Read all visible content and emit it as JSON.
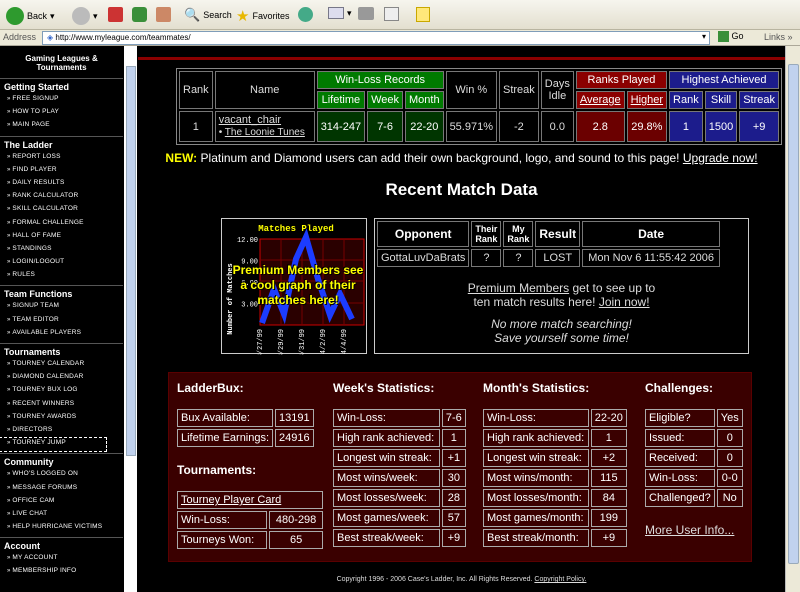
{
  "toolbar": {
    "back": "Back",
    "search": "Search",
    "favorites": "Favorites"
  },
  "address": {
    "label": "Address",
    "url": "http://www.myleague.com/teammates/",
    "go": "Go",
    "links": "Links"
  },
  "logo": "Gaming Leagues & Tournaments",
  "sidebar": [
    {
      "heading": "Getting Started",
      "items": [
        "FREE SIGNUP",
        "HOW TO PLAY",
        "MAIN PAGE"
      ]
    },
    {
      "heading": "The Ladder",
      "items": [
        "REPORT LOSS",
        "FIND PLAYER",
        "DAILY RESULTS",
        "RANK CALCULATOR",
        "SKILL CALCULATOR",
        "FORMAL CHALLENGE",
        "HALL OF FAME",
        "STANDINGS",
        "LOGIN/LOGOUT",
        "RULES"
      ]
    },
    {
      "heading": "Team Functions",
      "items": [
        "SIGNUP TEAM",
        "TEAM EDITOR",
        "AVAILABLE PLAYERS"
      ]
    },
    {
      "heading": "Tournaments",
      "items": [
        "TOURNEY CALENDAR",
        "DIAMOND CALENDAR",
        "TOURNEY BUX LOG",
        "RECENT WINNERS",
        "TOURNEY AWARDS",
        "DIRECTORS",
        "TOURNEY JUMP"
      ]
    },
    {
      "heading": "Community",
      "items": [
        "WHO'S LOGGED ON",
        "MESSAGE FORUMS",
        "OFFICE CAM",
        "LIVE CHAT",
        "HELP HURRICANE VICTIMS"
      ]
    },
    {
      "heading": "Account",
      "items": [
        "MY ACCOUNT",
        "MEMBERSHIP INFO"
      ]
    }
  ],
  "rank": {
    "h_rank": "Rank",
    "h_name": "Name",
    "h_wl": "Win-Loss Records",
    "h_win": "Win %",
    "h_streak": "Streak",
    "h_days": "Days Idle",
    "h_ranks": "Ranks Played",
    "h_high": "Highest Achieved",
    "s_lifetime": "Lifetime",
    "s_week": "Week",
    "s_month": "Month",
    "s_average": "Average",
    "s_higher": "Higher",
    "s_rank": "Rank",
    "s_skill": "Skill",
    "s_streak": "Streak",
    "v_rank": "1",
    "v_name": "vacant_chair",
    "v_team": "The Loonie Tunes",
    "v_lifetime": "314-247",
    "v_week": "7-6",
    "v_month": "22-20",
    "v_win": "55.971%",
    "v_streak": "-2",
    "v_days": "0.0",
    "v_average": "2.8",
    "v_higher": "29.8%",
    "v_hrank": "1",
    "v_skill": "1500",
    "v_hstreak": "+9"
  },
  "notice": {
    "new": "NEW:",
    "text": "Platinum and Diamond users can add their own background, logo, and sound to this page!",
    "link": "Upgrade now!"
  },
  "recent_title": "Recent Match Data",
  "graph": {
    "title": "Matches Played",
    "ylabel": "Number of Matches",
    "yticks": [
      "12.00",
      "9.00",
      "6.00",
      "3.00"
    ],
    "xticks": [
      "3/27/99",
      "3/29/99",
      "3/31/99",
      "4/2/99",
      "4/4/99"
    ],
    "overlay": "Premium Members see a cool graph of their matches here!"
  },
  "matches": {
    "h_opp": "Opponent",
    "h_their": "Their Rank",
    "h_my": "My Rank",
    "h_result": "Result",
    "h_date": "Date",
    "rows": [
      {
        "opp": "GottaLuvDaBrats",
        "their": "?",
        "my": "?",
        "result": "LOST",
        "date": "Mon Nov 6 11:55:42 2006"
      }
    ],
    "promo_link": "Premium Members",
    "promo1": "get to see up to",
    "promo2": "ten match results here!",
    "promo_join": "Join now!",
    "msg1": "No more match searching!",
    "msg2": "Save yourself some time!"
  },
  "ladderbux": {
    "title": "LadderBux:",
    "rows": [
      [
        "Bux Available:",
        "13191"
      ],
      [
        "Lifetime Earnings:",
        "24916"
      ]
    ]
  },
  "tournaments": {
    "title": "Tournaments:",
    "card": "Tourney Player Card",
    "rows": [
      [
        "Win-Loss:",
        "480-298"
      ],
      [
        "Tourneys Won:",
        "65"
      ]
    ]
  },
  "week": {
    "title": "Week's Statistics:",
    "rows": [
      [
        "Win-Loss:",
        "7-6"
      ],
      [
        "High rank achieved:",
        "1"
      ],
      [
        "Longest win streak:",
        "+1"
      ],
      [
        "Most wins/week:",
        "30"
      ],
      [
        "Most losses/week:",
        "28"
      ],
      [
        "Most games/week:",
        "57"
      ],
      [
        "Best streak/week:",
        "+9"
      ]
    ]
  },
  "month": {
    "title": "Month's Statistics:",
    "rows": [
      [
        "Win-Loss:",
        "22-20"
      ],
      [
        "High rank achieved:",
        "1"
      ],
      [
        "Longest win streak:",
        "+2"
      ],
      [
        "Most wins/month:",
        "115"
      ],
      [
        "Most losses/month:",
        "84"
      ],
      [
        "Most games/month:",
        "199"
      ],
      [
        "Best streak/month:",
        "+9"
      ]
    ]
  },
  "challenges": {
    "title": "Challenges:",
    "rows": [
      [
        "Eligible?",
        "Yes"
      ],
      [
        "Issued:",
        "0"
      ],
      [
        "Received:",
        "0"
      ],
      [
        "Win-Loss:",
        "0-0"
      ],
      [
        "Challenged?",
        "No"
      ]
    ],
    "more": "More User Info..."
  },
  "footer": {
    "text": "Copyright 1996 - 2006 Case's Ladder, Inc. All Rights Reserved.",
    "link": "Copyright Policy."
  }
}
